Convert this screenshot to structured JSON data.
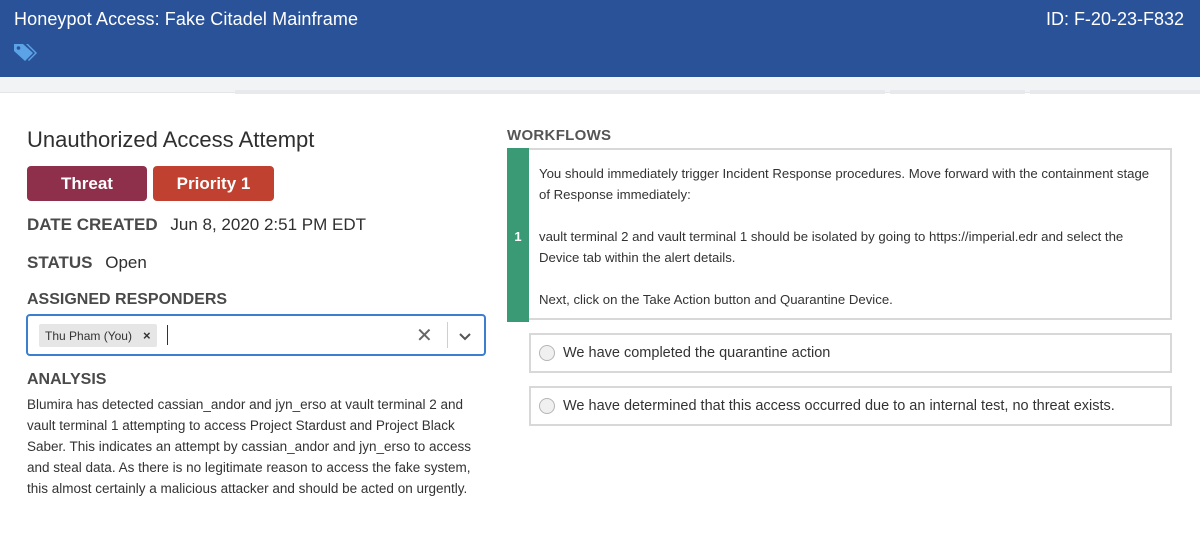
{
  "header": {
    "title": "Honeypot Access: Fake Citadel Mainframe",
    "id_label": "ID: F-20-23-F832",
    "tag_icon": "tags-icon",
    "background_color": "#2a5298"
  },
  "finding": {
    "title": "Unauthorized Access Attempt",
    "badges": [
      {
        "label": "Threat",
        "color": "#8e2f4b"
      },
      {
        "label": "Priority 1",
        "color": "#c0412f"
      }
    ],
    "date_created_label": "DATE CREATED",
    "date_created_value": "Jun 8, 2020 2:51 PM EDT",
    "status_label": "STATUS",
    "status_value": "Open",
    "assigned_label": "ASSIGNED RESPONDERS",
    "assigned_chips": [
      "Thu Pham (You)"
    ],
    "analysis_label": "ANALYSIS",
    "analysis_text": "Blumira has detected cassian_andor and jyn_erso at vault terminal 2 and vault terminal 1 attempting to access Project Stardust and Project Black Saber. This indicates an attempt by cassian_andor and jyn_erso to access and steal data. As there is no legitimate reason to access the fake system, this almost certainly a malicious attacker and should be acted on urgently."
  },
  "workflows": {
    "title": "WORKFLOWS",
    "step_number": "1",
    "step_color": "#3a9a76",
    "paragraphs": [
      "You should immediately trigger Incident Response procedures. Move forward with the containment stage of Response immediately:",
      "vault terminal 2 and vault terminal 1 should be isolated by going to https://imperial.edr and select the Device tab within the alert details.",
      "Next, click on the Take Action button and Quarantine Device."
    ],
    "options": [
      "We have completed the quarantine action",
      "We have determined that this access occurred due to an internal test, no threat exists."
    ]
  }
}
